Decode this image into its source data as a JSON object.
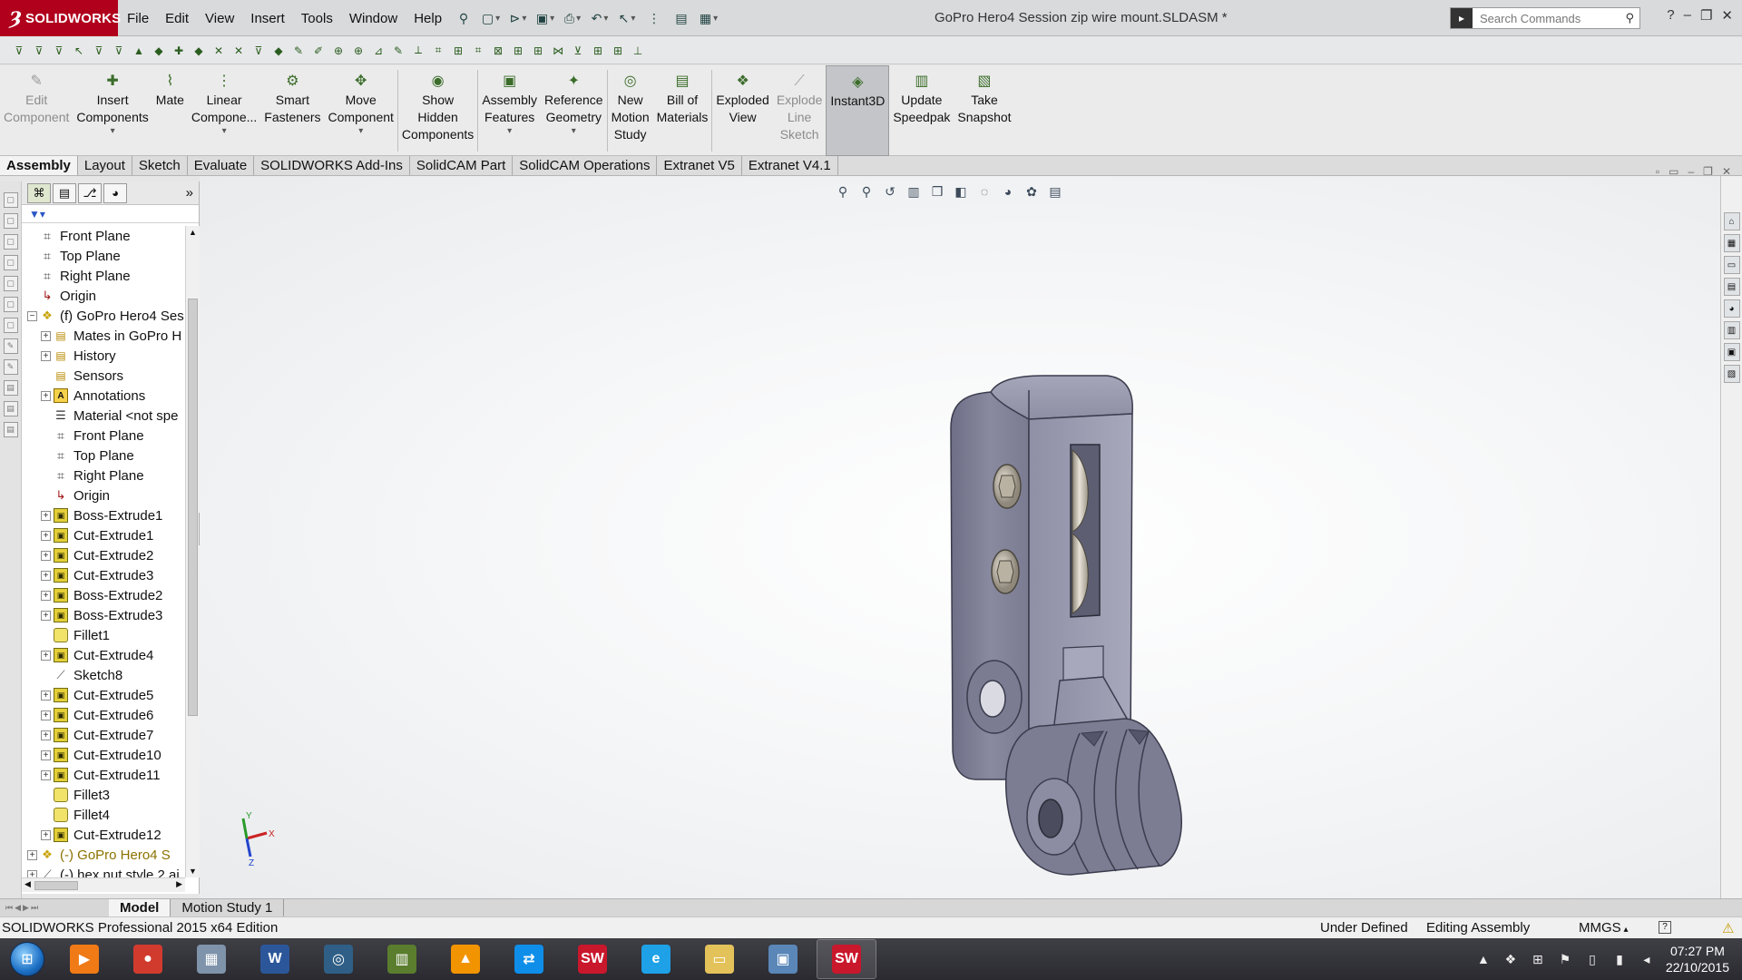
{
  "app": {
    "logo_text": "SOLIDWORKS",
    "document_title": "GoPro Hero4 Session zip wire mount.SLDASM *",
    "search_placeholder": "Search Commands"
  },
  "menu": [
    "File",
    "Edit",
    "View",
    "Insert",
    "Tools",
    "Window",
    "Help"
  ],
  "command_manager": [
    {
      "label": "Edit\nComponent",
      "icon": "edit-component-icon",
      "disabled": true
    },
    {
      "label": "Insert\nComponents",
      "icon": "insert-components-icon",
      "dropdown": true
    },
    {
      "label": "Mate",
      "icon": "mate-icon"
    },
    {
      "label": "Linear\nCompone...",
      "icon": "linear-pattern-icon",
      "dropdown": true
    },
    {
      "label": "Smart\nFasteners",
      "icon": "smart-fasteners-icon"
    },
    {
      "label": "Move\nComponent",
      "icon": "move-component-icon",
      "dropdown": true
    },
    {
      "sep": true
    },
    {
      "label": "Show\nHidden\nComponents",
      "icon": "show-hidden-icon"
    },
    {
      "sep": true
    },
    {
      "label": "Assembly\nFeatures",
      "icon": "assembly-features-icon",
      "dropdown": true
    },
    {
      "label": "Reference\nGeometry",
      "icon": "reference-geometry-icon",
      "dropdown": true
    },
    {
      "sep": true
    },
    {
      "label": "New\nMotion\nStudy",
      "icon": "motion-study-icon"
    },
    {
      "label": "Bill of\nMaterials",
      "icon": "bom-icon"
    },
    {
      "sep": true
    },
    {
      "label": "Exploded\nView",
      "icon": "exploded-view-icon"
    },
    {
      "label": "Explode\nLine\nSketch",
      "icon": "explode-line-icon",
      "disabled": true
    },
    {
      "label": "Instant3D",
      "icon": "instant3d-icon",
      "active": true
    },
    {
      "label": "Update\nSpeedpak",
      "icon": "speedpak-icon"
    },
    {
      "label": "Take\nSnapshot",
      "icon": "snapshot-icon"
    }
  ],
  "tabs": [
    {
      "label": "Assembly",
      "active": true
    },
    {
      "label": "Layout"
    },
    {
      "label": "Sketch"
    },
    {
      "label": "Evaluate"
    },
    {
      "label": "SOLIDWORKS Add-Ins"
    },
    {
      "label": "SolidCAM Part"
    },
    {
      "label": "SolidCAM Operations"
    },
    {
      "label": "Extranet V5"
    },
    {
      "label": "Extranet V4.1"
    }
  ],
  "feature_tree": [
    {
      "label": "Front Plane",
      "icon": "plane",
      "level": 0,
      "expander": false
    },
    {
      "label": "Top Plane",
      "icon": "plane",
      "level": 0,
      "expander": false
    },
    {
      "label": "Right Plane",
      "icon": "plane",
      "level": 0,
      "expander": false
    },
    {
      "label": "Origin",
      "icon": "origin",
      "level": 0,
      "expander": false
    },
    {
      "label": "(f) GoPro Hero4 Ses",
      "icon": "asm",
      "level": 0,
      "expander": "−"
    },
    {
      "label": "Mates in GoPro H",
      "icon": "folder",
      "level": 1,
      "expander": "+"
    },
    {
      "label": "History",
      "icon": "folder",
      "level": 1,
      "expander": "+"
    },
    {
      "label": "Sensors",
      "icon": "folder",
      "level": 1,
      "expander": false
    },
    {
      "label": "Annotations",
      "icon": "anno",
      "level": 1,
      "expander": "+"
    },
    {
      "label": "Material <not spe",
      "icon": "mat",
      "level": 1,
      "expander": false
    },
    {
      "label": "Front Plane",
      "icon": "plane",
      "level": 1,
      "expander": false
    },
    {
      "label": "Top Plane",
      "icon": "plane",
      "level": 1,
      "expander": false
    },
    {
      "label": "Right Plane",
      "icon": "plane",
      "level": 1,
      "expander": false
    },
    {
      "label": "Origin",
      "icon": "origin",
      "level": 1,
      "expander": false
    },
    {
      "label": "Boss-Extrude1",
      "icon": "feat",
      "level": 1,
      "expander": "+"
    },
    {
      "label": "Cut-Extrude1",
      "icon": "feat",
      "level": 1,
      "expander": "+"
    },
    {
      "label": "Cut-Extrude2",
      "icon": "feat",
      "level": 1,
      "expander": "+"
    },
    {
      "label": "Cut-Extrude3",
      "icon": "feat",
      "level": 1,
      "expander": "+"
    },
    {
      "label": "Boss-Extrude2",
      "icon": "feat",
      "level": 1,
      "expander": "+"
    },
    {
      "label": "Boss-Extrude3",
      "icon": "feat",
      "level": 1,
      "expander": "+"
    },
    {
      "label": "Fillet1",
      "icon": "fillet",
      "level": 1,
      "expander": false
    },
    {
      "label": "Cut-Extrude4",
      "icon": "feat",
      "level": 1,
      "expander": "+"
    },
    {
      "label": "Sketch8",
      "icon": "sketch",
      "level": 1,
      "expander": false
    },
    {
      "label": "Cut-Extrude5",
      "icon": "feat",
      "level": 1,
      "expander": "+"
    },
    {
      "label": "Cut-Extrude6",
      "icon": "feat",
      "level": 1,
      "expander": "+"
    },
    {
      "label": "Cut-Extrude7",
      "icon": "feat",
      "level": 1,
      "expander": "+"
    },
    {
      "label": "Cut-Extrude10",
      "icon": "feat",
      "level": 1,
      "expander": "+"
    },
    {
      "label": "Cut-Extrude11",
      "icon": "feat",
      "level": 1,
      "expander": "+"
    },
    {
      "label": "Fillet3",
      "icon": "fillet",
      "level": 1,
      "expander": false
    },
    {
      "label": "Fillet4",
      "icon": "fillet",
      "level": 1,
      "expander": false
    },
    {
      "label": "Cut-Extrude12",
      "icon": "feat",
      "level": 1,
      "expander": "+"
    },
    {
      "label": "(-) GoPro Hero4 S",
      "icon": "asm",
      "level": 0,
      "expander": "+",
      "warn": true
    },
    {
      "label": "(-) hex nut style 2 ai",
      "icon": "sketch",
      "level": 0,
      "expander": "+"
    }
  ],
  "bottom_tabs": [
    {
      "label": "Model",
      "active": true
    },
    {
      "label": "Motion Study 1"
    }
  ],
  "status": {
    "product": "SOLIDWORKS Professional 2015 x64 Edition",
    "definition": "Under Defined",
    "mode": "Editing Assembly",
    "units": "MMGS"
  },
  "triad": {
    "x": "X",
    "y": "Y",
    "z": "Z"
  },
  "taskbar": {
    "apps": [
      {
        "name": "media-player",
        "color": "#f07a16",
        "glyph": "▶"
      },
      {
        "name": "chrome",
        "color": "#d13b2e",
        "glyph": "●"
      },
      {
        "name": "calculator",
        "color": "#7f93aa",
        "glyph": "▦"
      },
      {
        "name": "word",
        "color": "#2b579a",
        "glyph": "W"
      },
      {
        "name": "app-blue",
        "color": "#2f5f86",
        "glyph": "◎"
      },
      {
        "name": "books",
        "color": "#5a7d2e",
        "glyph": "▥"
      },
      {
        "name": "vlc",
        "color": "#f29400",
        "glyph": "▲"
      },
      {
        "name": "teamviewer",
        "color": "#0e8ee9",
        "glyph": "⇄"
      },
      {
        "name": "solidworks-2015",
        "color": "#c9172c",
        "glyph": "SW"
      },
      {
        "name": "internet-explorer",
        "color": "#1ea1e6",
        "glyph": "e"
      },
      {
        "name": "file-explorer",
        "color": "#e4c25a",
        "glyph": "▭"
      },
      {
        "name": "image-viewer",
        "color": "#5a86b8",
        "glyph": "▣"
      },
      {
        "name": "solidworks-running",
        "color": "#c9172c",
        "glyph": "SW",
        "running": true
      }
    ],
    "time": "07:27 PM",
    "date": "22/10/2015"
  }
}
